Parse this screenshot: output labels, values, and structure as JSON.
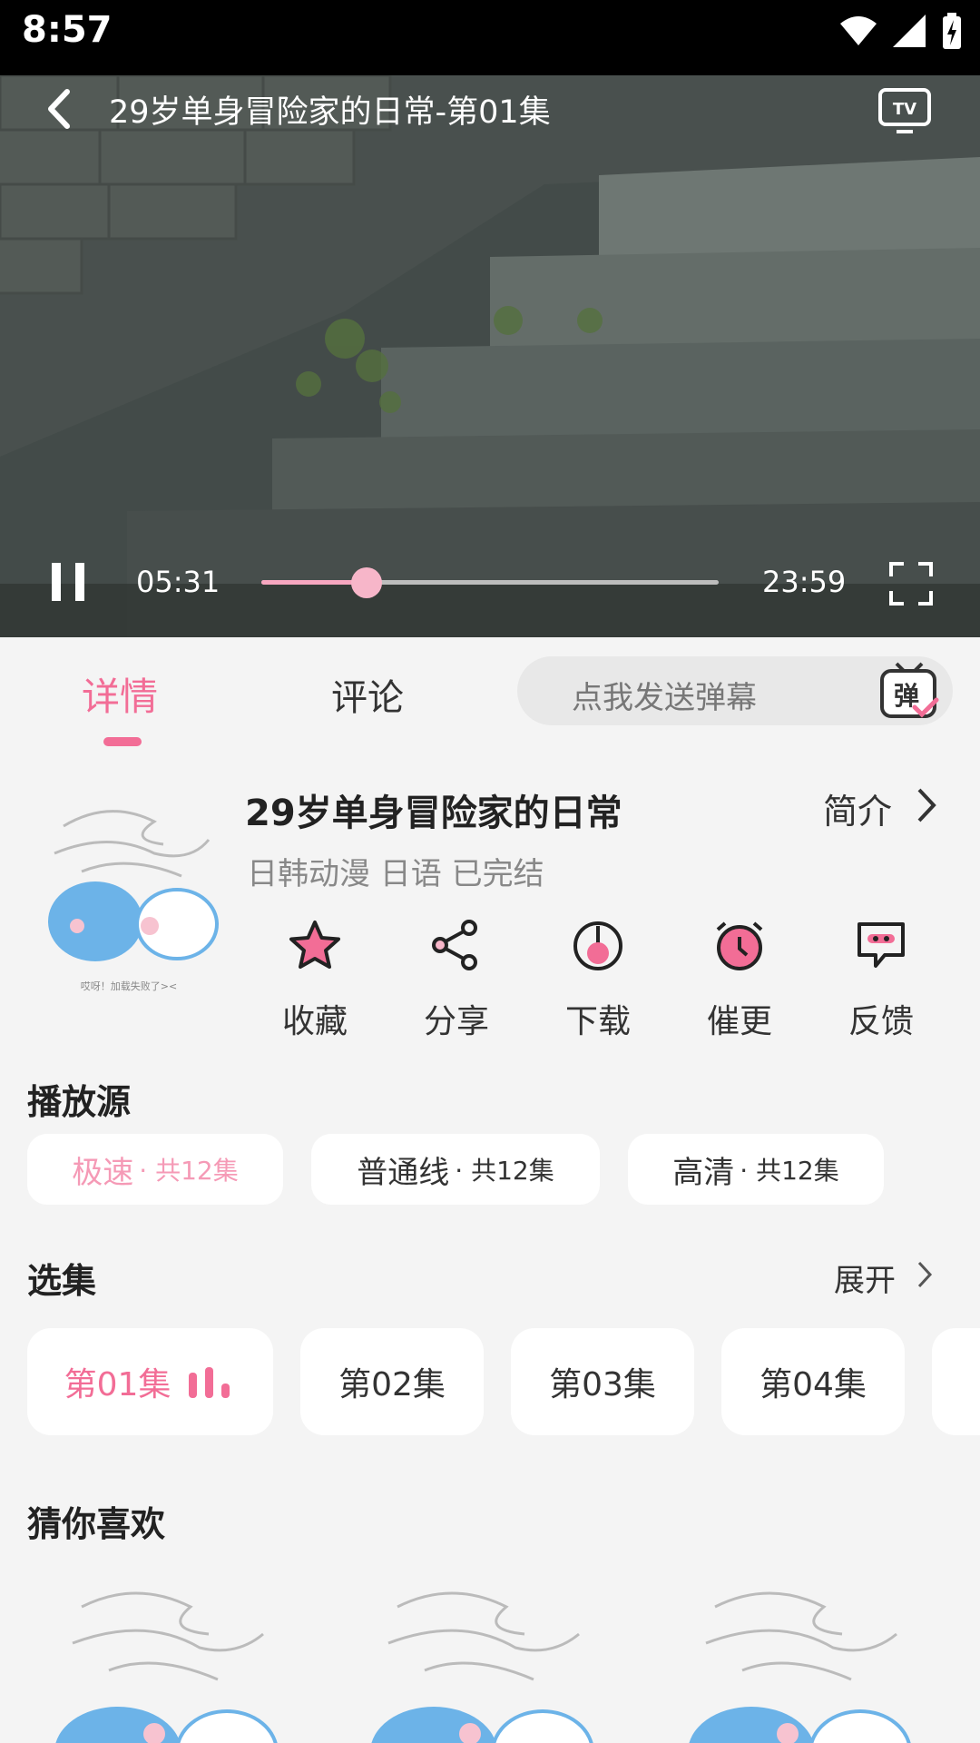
{
  "status_bar": {
    "time": "8:57"
  },
  "player": {
    "title": "29岁单身冒险家的日常-第01集",
    "current_time": "05:31",
    "total_time": "23:59",
    "progress_fraction": 0.23,
    "accent": "#f7a7c0"
  },
  "tabs": {
    "details": "详情",
    "comments": "评论"
  },
  "danmaku": {
    "placeholder": "点我发送弹幕",
    "button_glyph": "弹"
  },
  "anime": {
    "title": "29岁单身冒险家的日常",
    "intro_label": "简介",
    "meta": "日韩动漫 日语 已完结",
    "load_fail_text": "哎呀！加载失败了><"
  },
  "actions": [
    {
      "label": "收藏",
      "icon": "star-icon"
    },
    {
      "label": "分享",
      "icon": "share-icon"
    },
    {
      "label": "下载",
      "icon": "download-icon"
    },
    {
      "label": "催更",
      "icon": "alarm-icon"
    },
    {
      "label": "反馈",
      "icon": "feedback-icon"
    }
  ],
  "sources": {
    "title": "播放源",
    "items": [
      {
        "name": "极速",
        "count": " · 共12集"
      },
      {
        "name": "普通线",
        "count": " · 共12集"
      },
      {
        "name": "高清",
        "count": " · 共12集"
      }
    ]
  },
  "episodes": {
    "title": "选集",
    "expand_label": "展开",
    "items": [
      "第01集",
      "第02集",
      "第03集",
      "第04集"
    ]
  },
  "recommend": {
    "title": "猜你喜欢"
  },
  "colors": {
    "pink": "#f26d96",
    "light_pink": "#f59ab6"
  }
}
